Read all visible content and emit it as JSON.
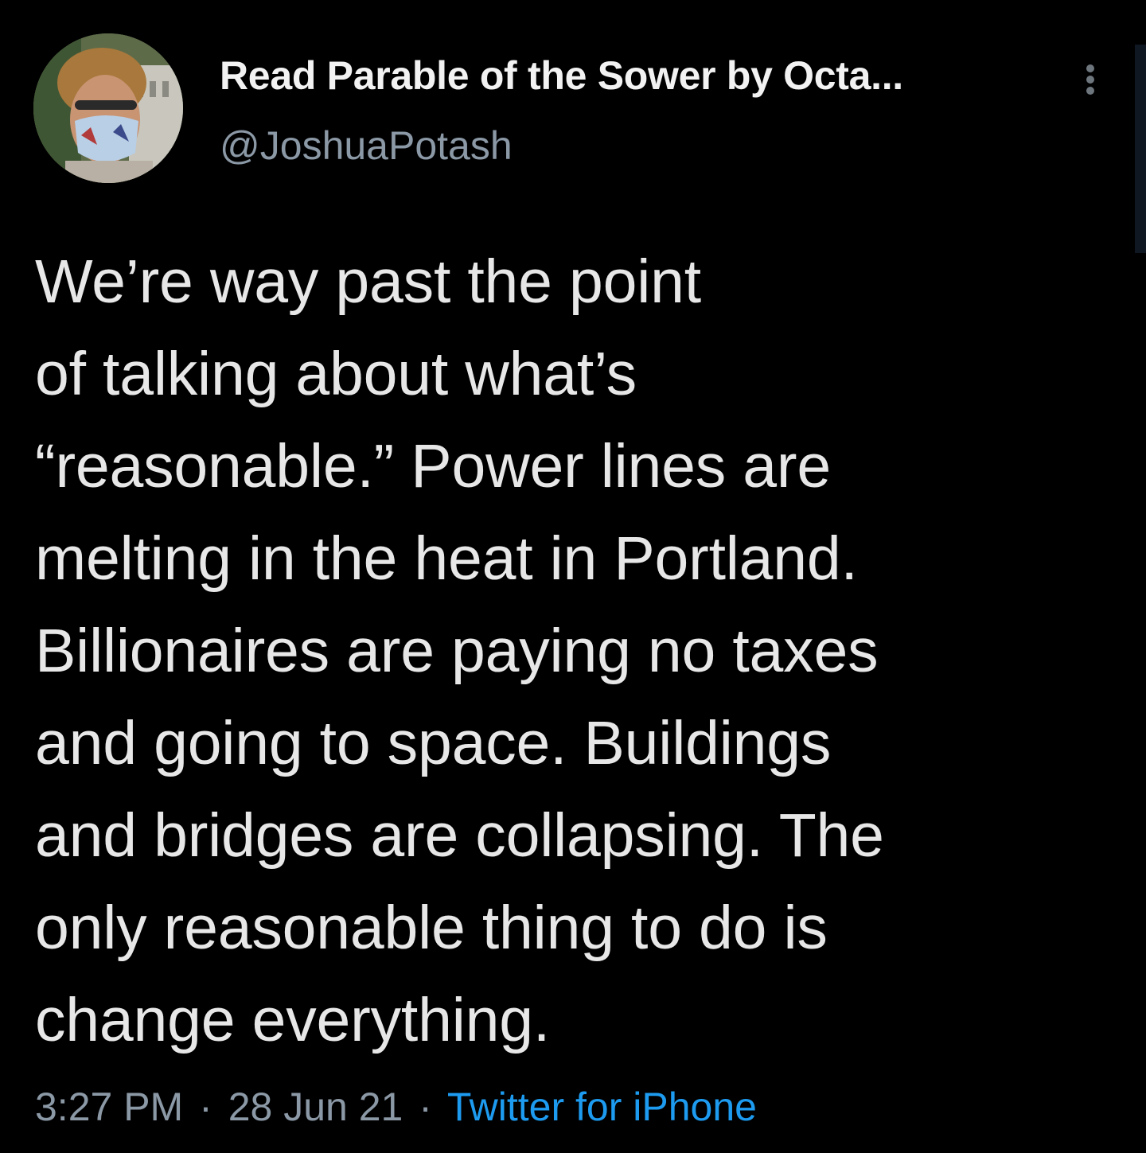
{
  "tweet": {
    "display_name": "Read Parable of the Sower by Octa...",
    "handle": "@JoshuaPotash",
    "avatar_icon": "profile-photo-avatar",
    "more_icon": "vertical-ellipsis-icon",
    "text_lines": [
      "We’re way past the point",
      "of talking about what’s",
      "“reasonable.” Power lines are",
      "melting in the heat in Portland.",
      "Billionaires are paying no taxes",
      "and going to space. Buildings",
      "and bridges are collapsing. The",
      "only reasonable thing to do is",
      "change everything."
    ],
    "time": "3:27 PM",
    "separator": "·",
    "date": "28 Jun 21",
    "source": "Twitter for iPhone"
  },
  "colors": {
    "background": "#000000",
    "text": "#e7e7e7",
    "muted": "#8b98a5",
    "link": "#1d9bf0"
  }
}
